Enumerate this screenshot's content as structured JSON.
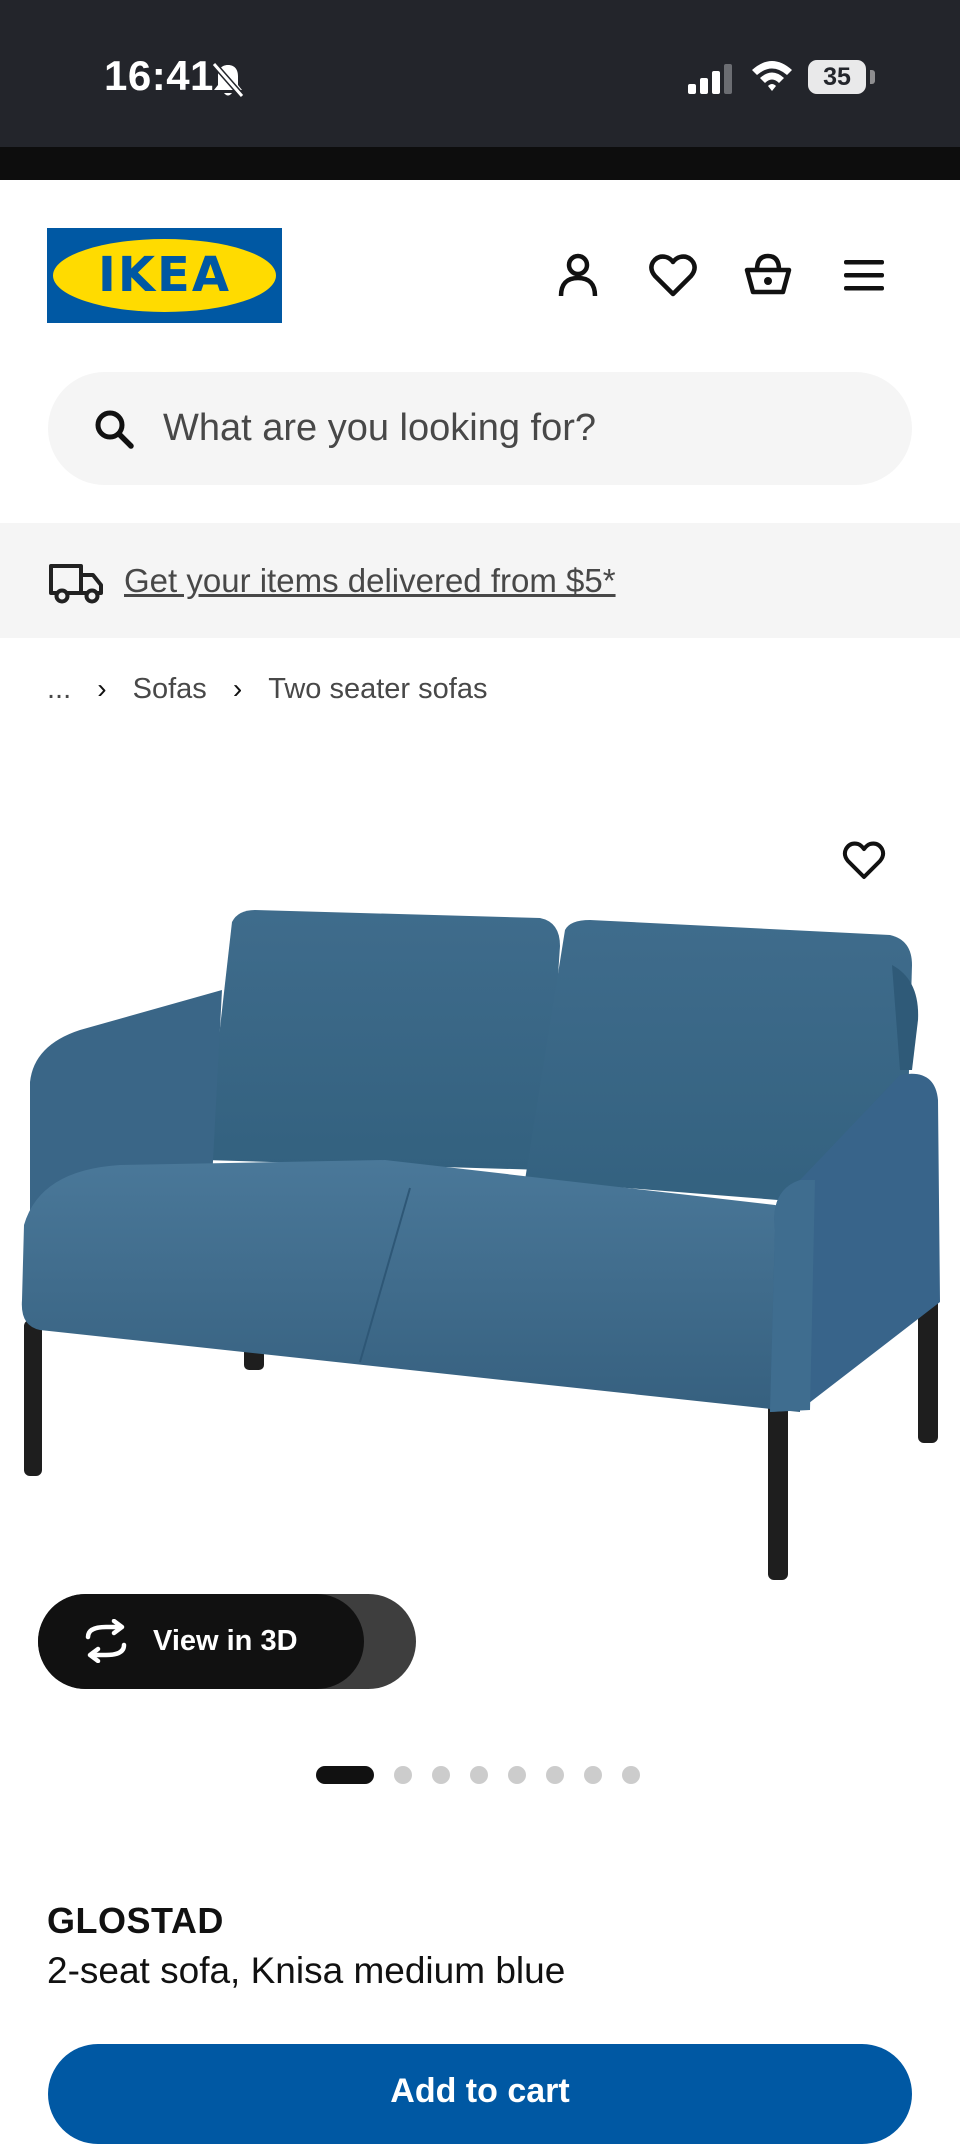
{
  "status_bar": {
    "time": "16:41",
    "battery": "35",
    "icons": [
      "bell-slash-icon",
      "cellular-signal-icon",
      "wifi-icon",
      "battery-icon"
    ]
  },
  "header": {
    "logo_text": "IKEA",
    "icons": [
      "account-icon",
      "heart-icon",
      "basket-icon",
      "menu-icon"
    ]
  },
  "search": {
    "placeholder": "What are you looking for?",
    "icon": "search-icon"
  },
  "delivery": {
    "text": "Get your items delivered from $5*",
    "icon": "truck-icon"
  },
  "breadcrumb": {
    "items": [
      "...",
      "Sofas",
      "Two seater sofas"
    ]
  },
  "gallery": {
    "favourite_icon": "heart-icon",
    "view3d_label": "View in 3D",
    "view3d_icon": "rotate-3d-icon",
    "image_count": 8,
    "active_index": 1
  },
  "product": {
    "name": "GLOSTAD",
    "description": "2-seat sofa, Knisa medium blue",
    "cart_label": "Add to cart"
  },
  "colors": {
    "brand_blue": "#0058a3",
    "brand_yellow": "#ffdb00",
    "sofa_blue": "#3d6a8a"
  }
}
